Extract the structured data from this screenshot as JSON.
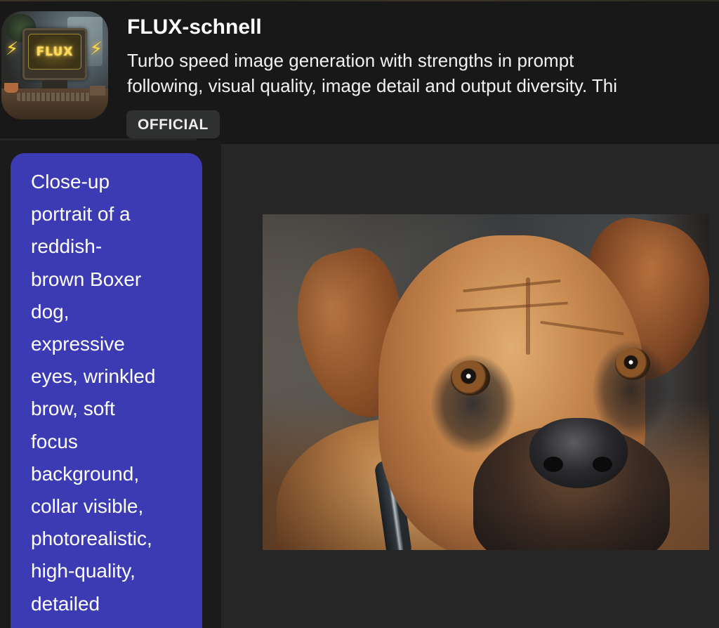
{
  "model": {
    "name": "FLUX-schnell",
    "description_line1": "Turbo speed image generation with strengths in prompt",
    "description_line2": "following, visual quality, image detail and output diversity. Thi",
    "badge": "OFFICIAL",
    "thumbnail": {
      "icon": "flux-retro-monitor-thumbnail",
      "screen_text": "FLUX",
      "bolt_glyph": "⚡"
    }
  },
  "conversation": {
    "prompt_message": {
      "role": "user",
      "text": "Close-up\nportrait of a\nreddish-\nbrown Boxer\ndog,\nexpressive\neyes, wrinkled\nbrow, soft\nfocus\nbackground,\ncollar visible,\nphotorealistic,\nhigh-quality,\ndetailed"
    },
    "response": {
      "type": "generated-image",
      "subject": "Close-up portrait of a reddish-brown Boxer dog"
    }
  },
  "colors": {
    "page_bg": "#181818",
    "panel_bg": "#262626",
    "prompt_bubble": "#3d3bb4",
    "badge_bg": "#2f3030",
    "text": "#ffffff"
  }
}
